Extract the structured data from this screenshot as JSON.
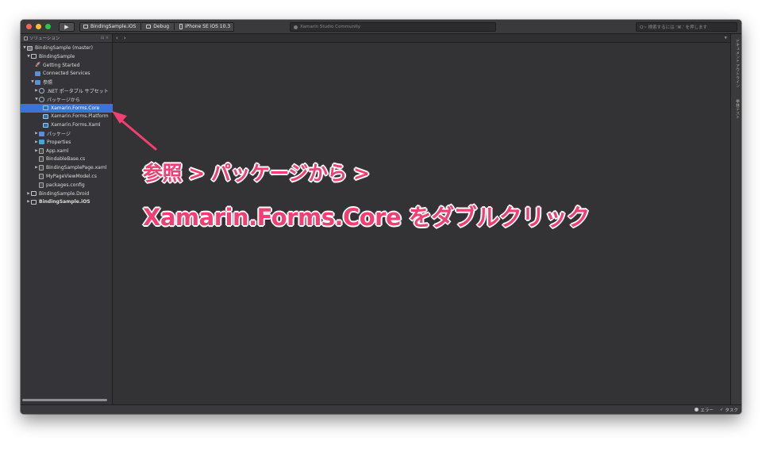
{
  "toolbar": {
    "traffic_colors": [
      "#fe5f57",
      "#febc2e",
      "#28c840"
    ],
    "run_icon": "play-icon",
    "project": "BindingSample.iOS",
    "configuration": "Debug",
    "device": "iPhone SE iOS 10.3",
    "status_text": "Xamarin Studio Community",
    "search_placeholder": "Q~ 検索するには '⌘.' を押します"
  },
  "solution_pad": {
    "title": "ソリューション",
    "controls": "⊟ ×",
    "items": [
      {
        "label": "BindingSample (master)",
        "icon": "solution-icon",
        "expanded": true
      },
      {
        "label": "BindingSample",
        "icon": "project-icon",
        "expanded": true
      },
      {
        "label": "Getting Started",
        "icon": "rocket-icon"
      },
      {
        "label": "Connected Services",
        "icon": "folder-icon"
      },
      {
        "label": "参照",
        "icon": "folder-icon",
        "expanded": true
      },
      {
        "label": ".NET ポータブル サブセット",
        "icon": "reference-icon",
        "expanded": false
      },
      {
        "label": "パッケージから",
        "icon": "reference-icon",
        "expanded": true
      },
      {
        "label": "Xamarin.Forms.Core",
        "icon": "package-icon",
        "selected": true
      },
      {
        "label": "Xamarin.Forms.Platform",
        "icon": "package-icon"
      },
      {
        "label": "Xamarin.Forms.Xaml",
        "icon": "package-icon"
      },
      {
        "label": "パッケージ",
        "icon": "folder-icon",
        "expanded": false
      },
      {
        "label": "Properties",
        "icon": "folder-icon",
        "expanded": false
      },
      {
        "label": "App.xaml",
        "icon": "file-icon",
        "expanded": false
      },
      {
        "label": "BindableBase.cs",
        "icon": "file-icon"
      },
      {
        "label": "BindingSamplePage.xaml",
        "icon": "file-icon",
        "expanded": false
      },
      {
        "label": "MyPageViewModel.cs",
        "icon": "file-icon"
      },
      {
        "label": "packages.config",
        "icon": "file-icon"
      },
      {
        "label": "BindingSample.Droid",
        "icon": "project-icon",
        "expanded": false
      },
      {
        "label": "BindingSample.iOS",
        "icon": "project-icon",
        "expanded": false,
        "bold": true
      }
    ]
  },
  "editor_nav": {
    "back": "‹",
    "forward": "›"
  },
  "right_tabs": [
    "ドキュメント アウトライン",
    "単体テスト"
  ],
  "status_bar": {
    "errors": "エラー",
    "tasks": "タスク"
  },
  "annotation": {
    "line1": "参照 > パッケージから >",
    "line2": "Xamarin.Forms.Core をダブルクリック",
    "color": "#f13f73"
  }
}
